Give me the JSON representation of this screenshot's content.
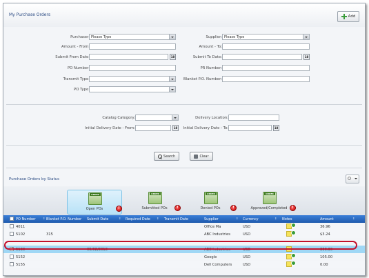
{
  "header": {
    "title": "My Purchase Orders",
    "add_label": "Add"
  },
  "form": {
    "purchaser_label": "Purchaser:",
    "purchaser_value": "Please Type",
    "supplier_label": "Supplier:",
    "supplier_value": "Please Type",
    "amount_from_label": "Amount - From:",
    "amount_to_label": "Amount - To:",
    "submit_from_label": "Submit From Date:",
    "submit_to_label": "Submit To Date:",
    "po_number_label": "PO Number:",
    "pr_number_label": "PR Number:",
    "transmit_type_label": "Transmit Type:",
    "blanket_po_label": "Blanket P.O. Number:",
    "po_type_label": "PO Type:",
    "catalog_category_label": "Catalog Category:",
    "delivery_location_label": "Delivery Location:",
    "initial_delivery_from_label": "Initial Delivery Date - From:",
    "initial_delivery_to_label": "Initial Delivery Date - To:",
    "calendar_text": "18"
  },
  "buttons": {
    "search": "Search",
    "clear": "Clear"
  },
  "status_section": {
    "title": "Purchase Orders by Status",
    "icon_tag": "ORDER",
    "items": [
      {
        "label": "Open POs",
        "active": true
      },
      {
        "label": "Submitted POs",
        "active": false
      },
      {
        "label": "Denied POs",
        "active": false
      },
      {
        "label": "Approved/Completed",
        "active": false
      }
    ]
  },
  "table": {
    "columns": [
      "PO Number",
      "Blanket P.O. Number",
      "Submit Date",
      "Required Date",
      "Transmit Date",
      "Supplier",
      "Currency",
      "Notes",
      "Amount"
    ],
    "rows": [
      {
        "po": "4011",
        "blanket": "",
        "submit": "",
        "supplier": "Office Ma",
        "currency": "USD",
        "amount": "36.96",
        "checked": false,
        "selected": false
      },
      {
        "po": "5102",
        "blanket": "315",
        "submit": "",
        "supplier": "ABC Industries",
        "currency": "USD",
        "amount": "$3.24",
        "checked": false,
        "selected": false
      },
      {
        "po": "5130",
        "blanket": "",
        "submit": "05/02/2018",
        "supplier": "ABC Industries",
        "currency": "USD",
        "amount": "300.30",
        "checked": true,
        "selected": true
      },
      {
        "po": "5152",
        "blanket": "",
        "submit": "",
        "supplier": "Google",
        "currency": "USD",
        "amount": "105.00",
        "checked": false,
        "selected": false
      },
      {
        "po": "5155",
        "blanket": "",
        "submit": "",
        "supplier": "Dell Computers",
        "currency": "USD",
        "amount": "0.00",
        "checked": false,
        "selected": false
      }
    ]
  }
}
